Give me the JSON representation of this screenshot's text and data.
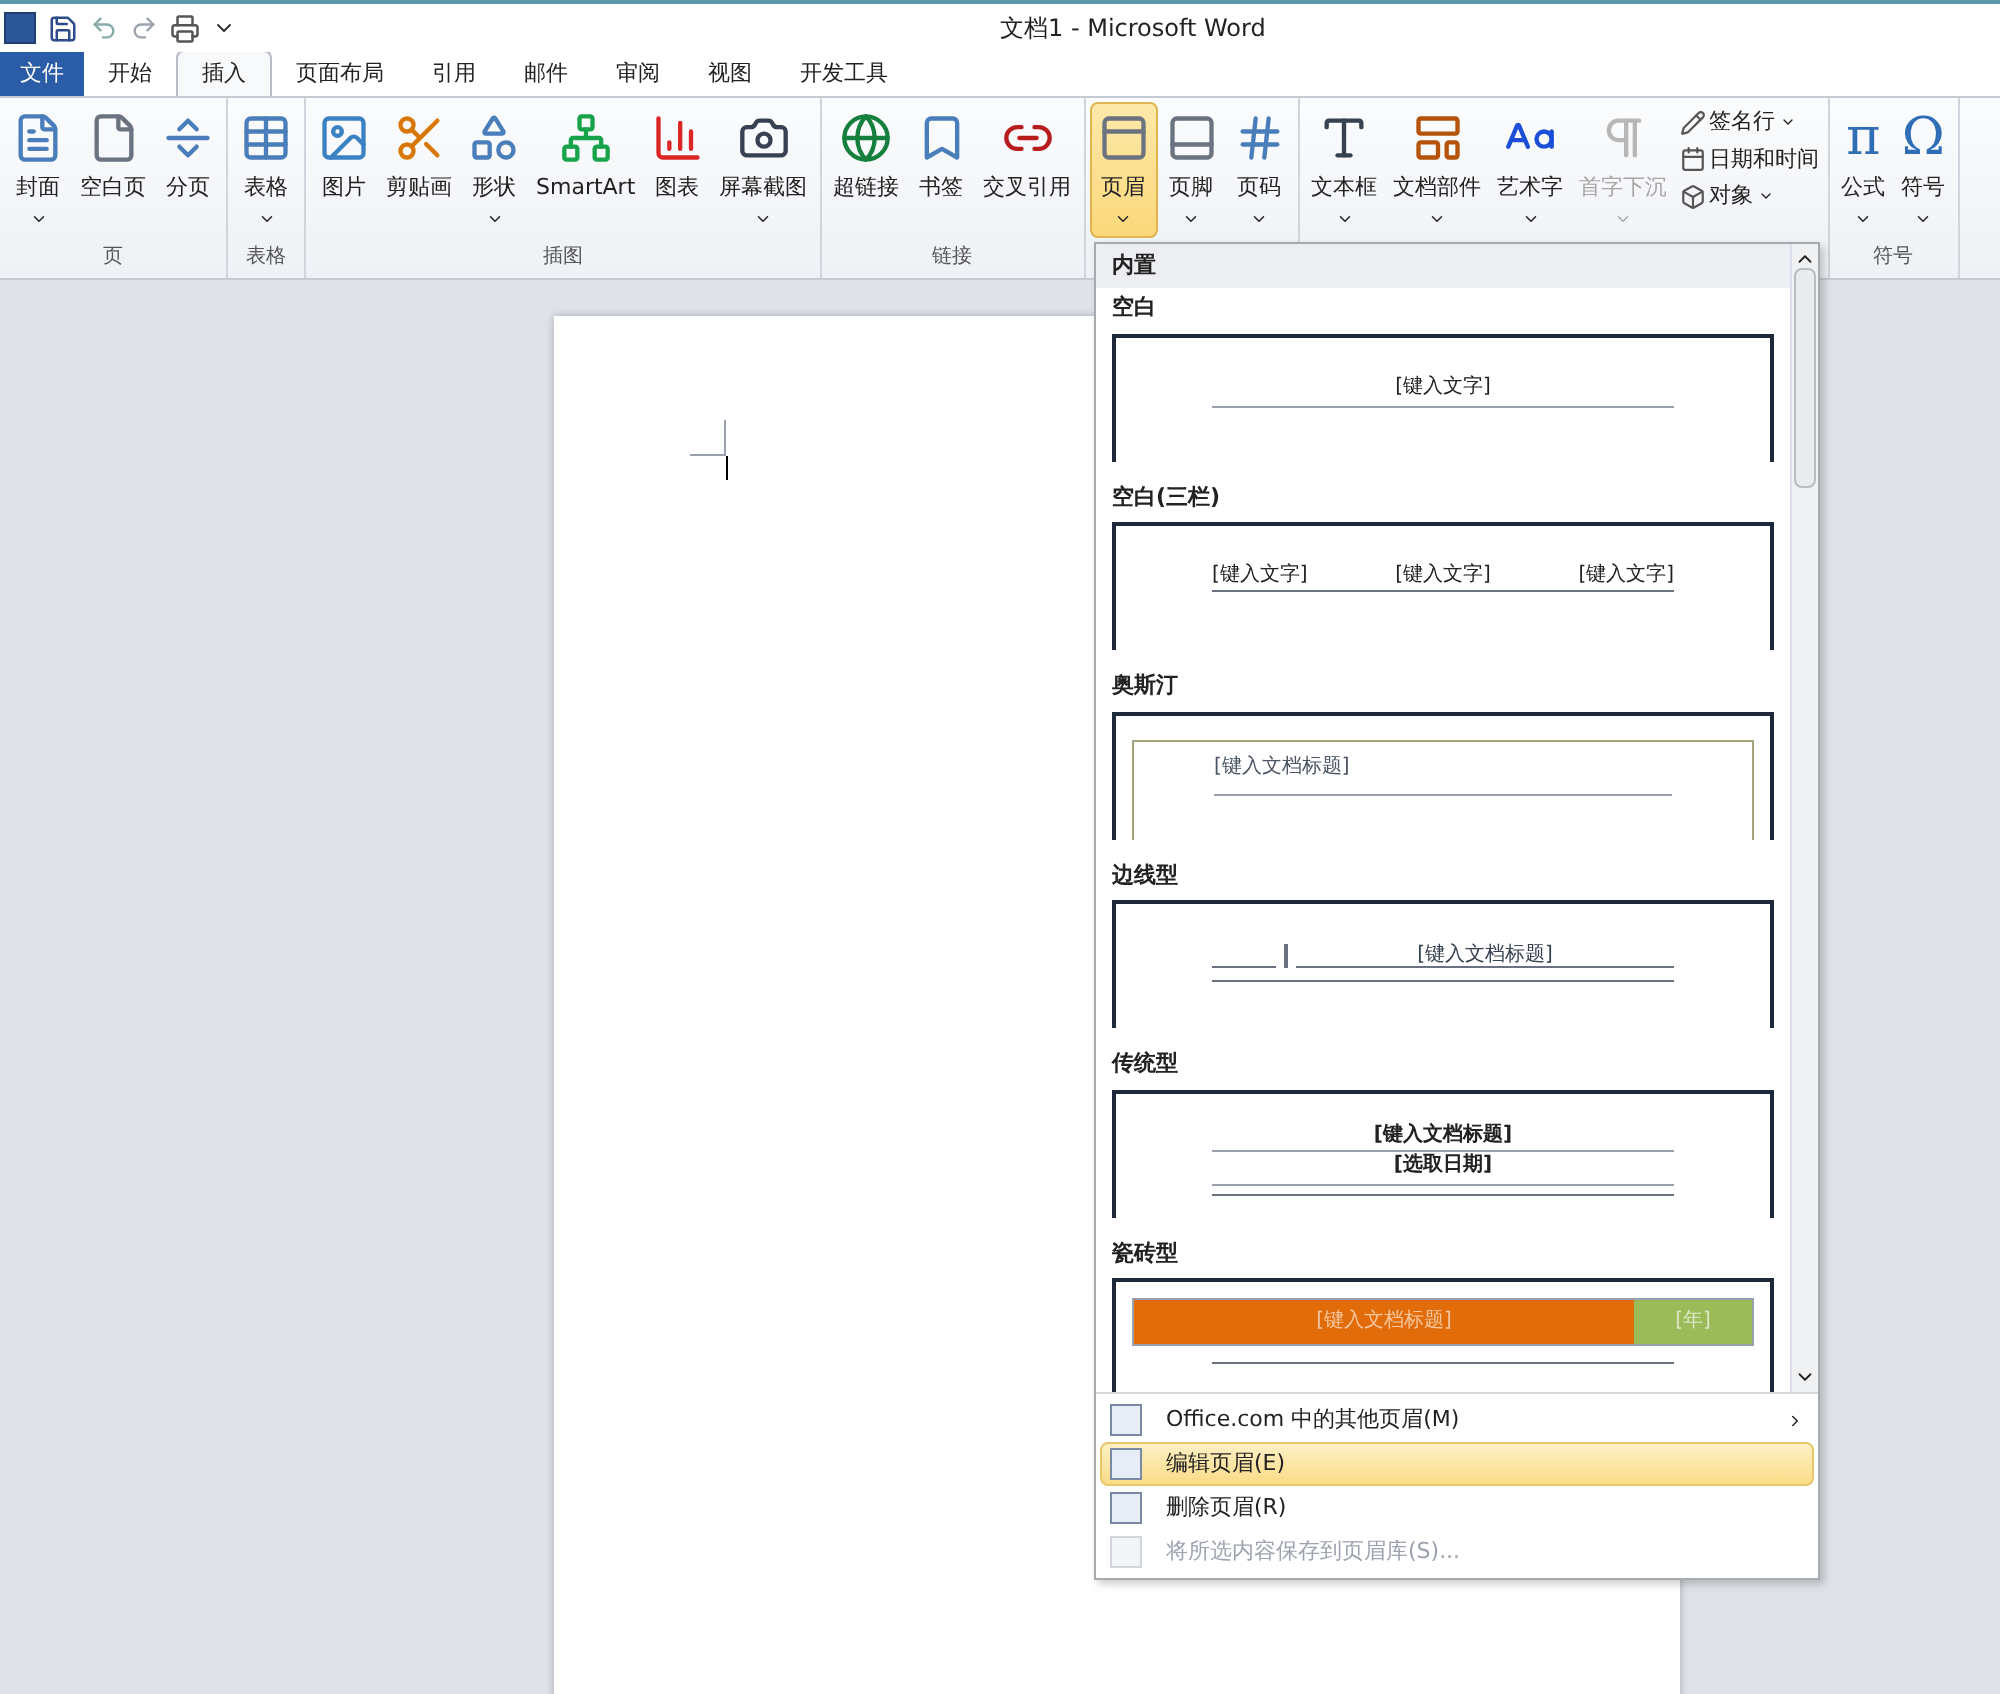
{
  "window": {
    "title": "文档1  -  Microsoft Word"
  },
  "tabs": [
    {
      "label": "文件",
      "kind": "file",
      "selected": false
    },
    {
      "label": "开始",
      "kind": "tab",
      "selected": false
    },
    {
      "label": "插入",
      "kind": "tab",
      "selected": true
    },
    {
      "label": "页面布局",
      "kind": "tab",
      "selected": false
    },
    {
      "label": "引用",
      "kind": "tab",
      "selected": false
    },
    {
      "label": "邮件",
      "kind": "tab",
      "selected": false
    },
    {
      "label": "审阅",
      "kind": "tab",
      "selected": false
    },
    {
      "label": "视图",
      "kind": "tab",
      "selected": false
    },
    {
      "label": "开发工具",
      "kind": "tab",
      "selected": false
    }
  ],
  "ribbon_groups": [
    {
      "label": "页",
      "buttons": [
        {
          "label": "封面",
          "dropdown": true,
          "active": false,
          "disabled": false
        },
        {
          "label": "空白页",
          "dropdown": false,
          "active": false,
          "disabled": false
        },
        {
          "label": "分页",
          "dropdown": false,
          "active": false,
          "disabled": false
        }
      ]
    },
    {
      "label": "表格",
      "buttons": [
        {
          "label": "表格",
          "dropdown": true,
          "active": false,
          "disabled": false
        }
      ]
    },
    {
      "label": "插图",
      "buttons": [
        {
          "label": "图片",
          "dropdown": false,
          "active": false,
          "disabled": false
        },
        {
          "label": "剪贴画",
          "dropdown": false,
          "active": false,
          "disabled": false
        },
        {
          "label": "形状",
          "dropdown": true,
          "active": false,
          "disabled": false
        },
        {
          "label": "SmartArt",
          "dropdown": false,
          "active": false,
          "disabled": false
        },
        {
          "label": "图表",
          "dropdown": false,
          "active": false,
          "disabled": false
        },
        {
          "label": "屏幕截图",
          "dropdown": true,
          "active": false,
          "disabled": false
        }
      ]
    },
    {
      "label": "链接",
      "buttons": [
        {
          "label": "超链接",
          "dropdown": false,
          "active": false,
          "disabled": false
        },
        {
          "label": "书签",
          "dropdown": false,
          "active": false,
          "disabled": false
        },
        {
          "label": "交叉引用",
          "dropdown": false,
          "active": false,
          "disabled": false
        }
      ]
    },
    {
      "buttons": [
        {
          "label": "页眉",
          "dropdown": true,
          "active": true,
          "disabled": false
        },
        {
          "label": "页脚",
          "dropdown": true,
          "active": false,
          "disabled": false
        },
        {
          "label": "页码",
          "dropdown": true,
          "active": false,
          "disabled": false
        }
      ]
    },
    {
      "buttons": [
        {
          "label": "文本框",
          "dropdown": true,
          "active": false,
          "disabled": false
        },
        {
          "label": "文档部件",
          "dropdown": true,
          "active": false,
          "disabled": false
        },
        {
          "label": "艺术字",
          "dropdown": true,
          "active": false,
          "disabled": false
        },
        {
          "label": "首字下沉",
          "dropdown": true,
          "active": false,
          "disabled": true
        }
      ],
      "small_buttons": [
        {
          "label": "签名行",
          "dropdown": true
        },
        {
          "label": "日期和时间",
          "dropdown": false
        },
        {
          "label": "对象",
          "dropdown": true
        }
      ]
    },
    {
      "label": "符号",
      "buttons": [
        {
          "label": "公式",
          "symbol": "π",
          "dropdown": true,
          "active": false,
          "disabled": false
        },
        {
          "label": "符号",
          "symbol": "Ω",
          "dropdown": true,
          "active": false,
          "disabled": false
        }
      ]
    }
  ],
  "header_menu": {
    "section": "内置",
    "gallery": [
      {
        "name": "空白",
        "kind": "blank",
        "texts": [
          "[键入文字]"
        ]
      },
      {
        "name": "空白(三栏)",
        "kind": "three",
        "texts": [
          "[键入文字]",
          "[键入文字]",
          "[键入文字]"
        ]
      },
      {
        "name": "奥斯汀",
        "kind": "austin",
        "texts": [
          "[键入文档标题]"
        ]
      },
      {
        "name": "边线型",
        "kind": "sideline",
        "texts": [
          "[键入文档标题]"
        ]
      },
      {
        "name": "传统型",
        "kind": "traditional",
        "texts": [
          "[键入文档标题]",
          "[选取日期]"
        ]
      },
      {
        "name": "瓷砖型",
        "kind": "tile",
        "texts": [
          "[键入文档标题]",
          "[年]"
        ]
      }
    ],
    "items": [
      {
        "label": "Office.com 中的其他页眉(M)",
        "highlighted": false,
        "disabled": false,
        "submenu": true
      },
      {
        "label": "编辑页眉(E)",
        "highlighted": true,
        "disabled": false,
        "submenu": false
      },
      {
        "label": "删除页眉(R)",
        "highlighted": false,
        "disabled": false,
        "submenu": false
      },
      {
        "label": "将所选内容保存到页眉库(S)...",
        "highlighted": false,
        "disabled": true,
        "submenu": false
      }
    ]
  }
}
